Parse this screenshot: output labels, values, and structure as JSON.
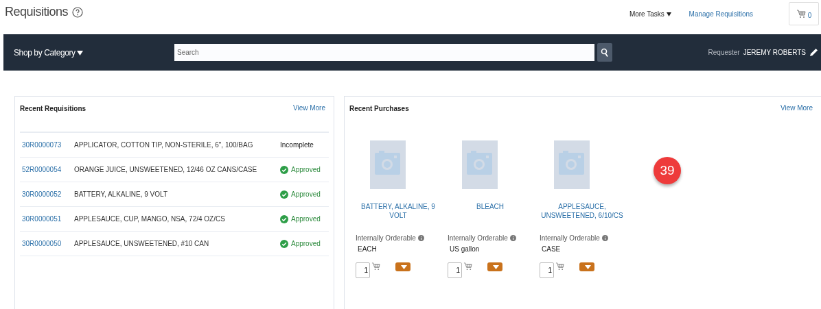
{
  "header": {
    "title": "Requisitions",
    "more_tasks": "More Tasks",
    "manage_link": "Manage Requisitions",
    "cart_count": "0"
  },
  "toolbar": {
    "category_menu": "Shop by Category",
    "search": {
      "placeholder": "Search"
    },
    "requester_label": "Requester",
    "requester_name": "JEREMY ROBERTS"
  },
  "recent_requisitions": {
    "title": "Recent Requisitions",
    "view_more": "View More",
    "rows": [
      {
        "id": "30R0000073",
        "description": "APPLICATOR, COTTON TIP, NON-STERILE, 6\", 100/BAG",
        "status": "Incomplete",
        "approved": false
      },
      {
        "id": "52R0000054",
        "description": "ORANGE JUICE, UNSWEETENED, 12/46 OZ CANS/CASE",
        "status": "Approved",
        "approved": true
      },
      {
        "id": "30R0000052",
        "description": "BATTERY, ALKALINE, 9 VOLT",
        "status": "Approved",
        "approved": true
      },
      {
        "id": "30R0000051",
        "description": "APPLESAUCE, CUP, MANGO, NSA, 72/4 OZ/CS",
        "status": "Approved",
        "approved": true
      },
      {
        "id": "30R0000050",
        "description": "APPLESAUCE, UNSWEETENED, #10 CAN",
        "status": "Approved",
        "approved": true
      }
    ]
  },
  "recent_purchases": {
    "title": "Recent Purchases",
    "view_more": "View More",
    "items": [
      {
        "name": "BATTERY, ALKALINE, 9 VOLT",
        "source": "Internally Orderable",
        "unit": "EACH",
        "quantity": "1"
      },
      {
        "name": "BLEACH",
        "source": "Internally Orderable",
        "unit": "US gallon",
        "quantity": "1"
      },
      {
        "name": "APPLESAUCE, UNSWEETENED, 6/10/CS",
        "source": "Internally Orderable",
        "unit": "CASE",
        "quantity": "1"
      }
    ]
  },
  "badge": "39"
}
